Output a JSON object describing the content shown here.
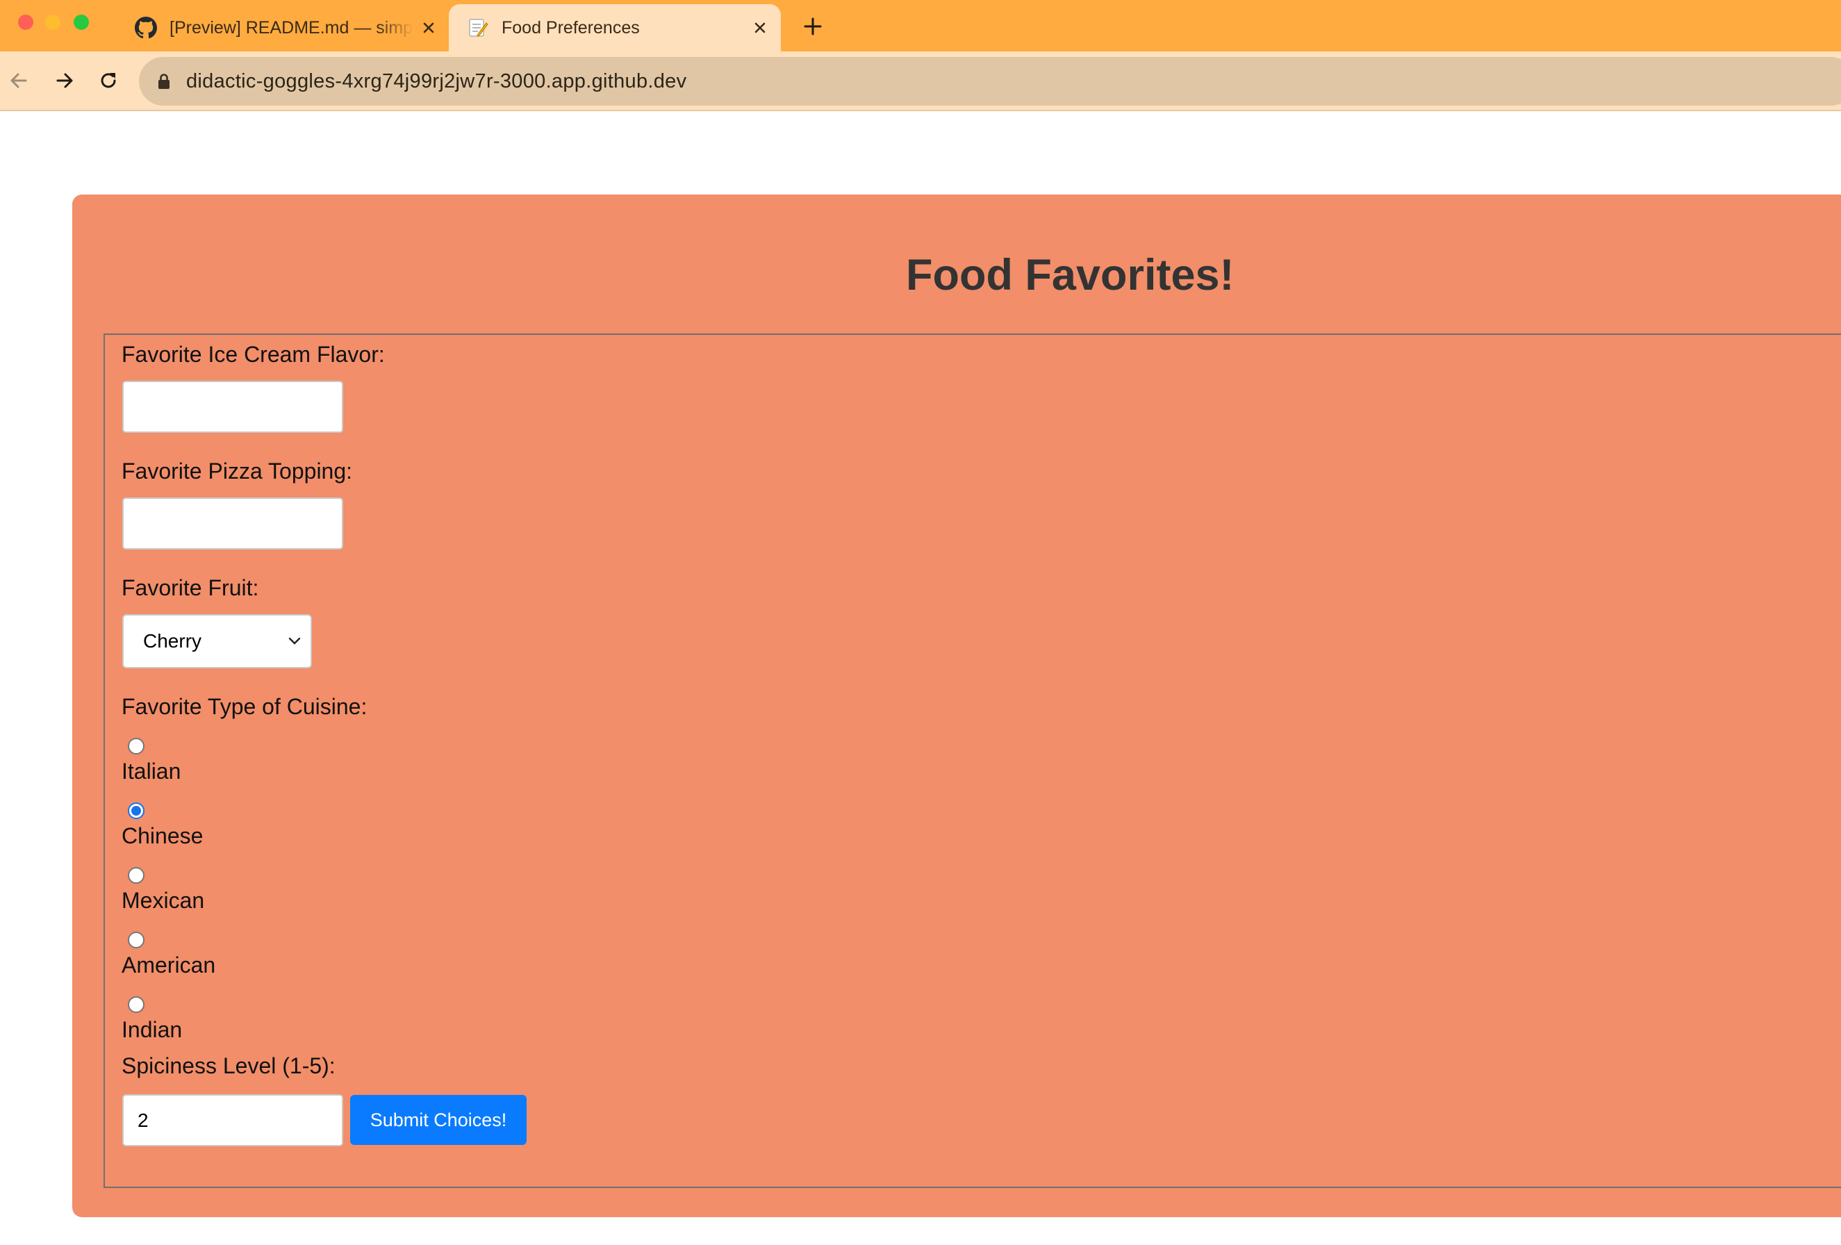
{
  "browser": {
    "tabs": [
      {
        "title": "[Preview] README.md — simple-forms",
        "favicon": "github-icon",
        "active": false
      },
      {
        "title": "Food Preferences",
        "favicon": "memo-icon",
        "active": true
      }
    ],
    "address_bar": {
      "url": "didactic-goggles-4xrg74j99rj2jw7r-3000.app.github.dev"
    }
  },
  "page": {
    "heading": "Food Favorites!",
    "form": {
      "ice_cream": {
        "label": "Favorite Ice Cream Flavor:",
        "value": ""
      },
      "pizza": {
        "label": "Favorite Pizza Topping:",
        "value": ""
      },
      "fruit": {
        "label": "Favorite Fruit:",
        "selected": "Cherry"
      },
      "cuisine": {
        "label": "Favorite Type of Cuisine:",
        "options": [
          "Italian",
          "Chinese",
          "Mexican",
          "American",
          "Indian"
        ],
        "selected": "Chinese"
      },
      "spiciness": {
        "label": "Spiciness Level (1-5):",
        "value": "2"
      },
      "submit_label": "Submit Choices!"
    }
  },
  "colors": {
    "tab_strip": "#ffab40",
    "toolbar": "#ffe0bc",
    "card_background": "#f28e69",
    "heading_text": "#333333",
    "submit_button": "#0a7bff",
    "radio_checked": "#1a73e8"
  }
}
